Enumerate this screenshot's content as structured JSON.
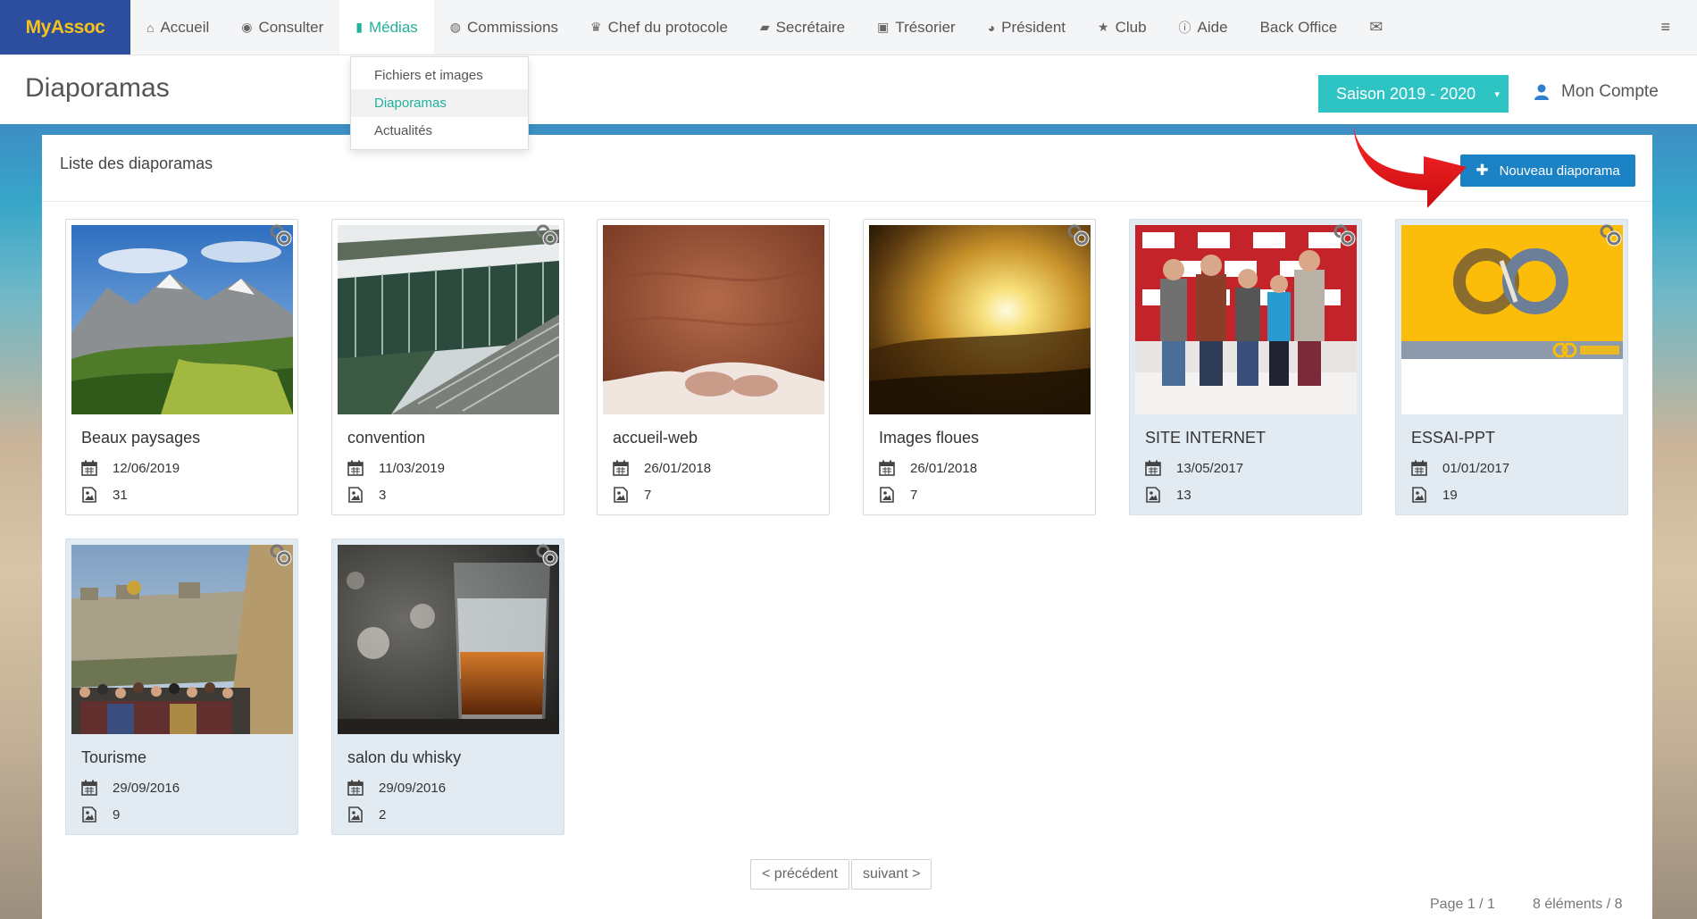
{
  "app": {
    "brand": "MyAssoc"
  },
  "nav": {
    "items": [
      {
        "icon": "home-icon",
        "glyph": "⌂",
        "label": "Accueil"
      },
      {
        "icon": "eye-icon",
        "glyph": "◉",
        "label": "Consulter"
      },
      {
        "icon": "file-icon",
        "glyph": "▮",
        "label": "Médias"
      },
      {
        "icon": "user-circle-icon",
        "glyph": "◍",
        "label": "Commissions"
      },
      {
        "icon": "trophy-icon",
        "glyph": "♛",
        "label": "Chef du protocole"
      },
      {
        "icon": "book-icon",
        "glyph": "▰",
        "label": "Secrétaire"
      },
      {
        "icon": "money-icon",
        "glyph": "▣",
        "label": "Trésorier"
      },
      {
        "icon": "globe-icon",
        "glyph": "◕",
        "label": "Président"
      },
      {
        "icon": "star-icon",
        "glyph": "★",
        "label": "Club"
      },
      {
        "icon": "info-icon",
        "glyph": "ⓘ",
        "label": "Aide"
      },
      {
        "icon": "",
        "glyph": "",
        "label": "Back Office"
      },
      {
        "icon": "envelope-icon",
        "glyph": "✉",
        "label": ""
      }
    ],
    "menu_icon": "≡"
  },
  "dropdown": {
    "items": [
      "Fichiers et images",
      "Diaporamas",
      "Actualités"
    ]
  },
  "header": {
    "title": "Diaporamas",
    "season": "Saison 2019 - 2020",
    "season_caret": "▾",
    "account": "Mon Compte"
  },
  "panel": {
    "title": "Liste des diaporamas",
    "new_button": "Nouveau diaporama",
    "plus": "✚"
  },
  "cards": [
    {
      "title": "Beaux paysages",
      "date": "12/06/2019",
      "count": "31",
      "thumb": "mountain-landscape"
    },
    {
      "title": "convention",
      "date": "11/03/2019",
      "count": "3",
      "thumb": "convention-building"
    },
    {
      "title": "accueil-web",
      "date": "26/01/2018",
      "count": "7",
      "thumb": "hand-closeup"
    },
    {
      "title": "Images floues",
      "date": "26/01/2018",
      "count": "7",
      "thumb": "blurred-sunset"
    },
    {
      "title": "SITE INTERNET",
      "date": "13/05/2017",
      "count": "13",
      "thumb": "people-photo"
    },
    {
      "title": "ESSAI-PPT",
      "date": "01/01/2017",
      "count": "19",
      "thumb": "myassoc-logo-slide"
    },
    {
      "title": "Tourisme",
      "date": "29/09/2016",
      "count": "9",
      "thumb": "city-crowd"
    },
    {
      "title": "salon du whisky",
      "date": "29/09/2016",
      "count": "2",
      "thumb": "whisky-glass"
    }
  ],
  "pagination": {
    "prev": "< précédent",
    "next": "suivant >",
    "page_info": "Page 1 / 1",
    "count_info": "8 éléments / 8"
  },
  "colors": {
    "brand_bg": "#2d4e9f",
    "brand_text": "#f6c21a",
    "active": "#22b19b",
    "season": "#2ec4c4",
    "primary": "#1b82c6",
    "arrow": "#e8141b"
  }
}
